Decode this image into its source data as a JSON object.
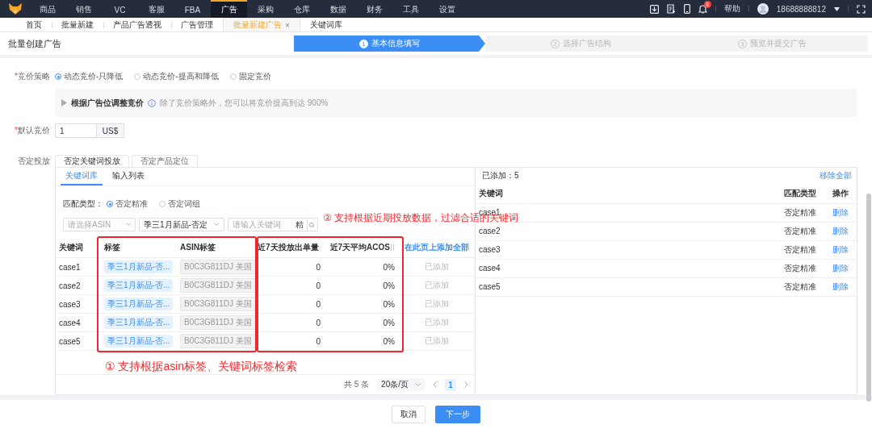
{
  "nav": {
    "items": [
      {
        "label": "商品",
        "selected": false
      },
      {
        "label": "销售",
        "selected": false
      },
      {
        "label": "VC",
        "selected": false
      },
      {
        "label": "客服",
        "selected": false
      },
      {
        "label": "FBA",
        "selected": false
      },
      {
        "label": "广告",
        "selected": true
      },
      {
        "label": "采购",
        "selected": false
      },
      {
        "label": "仓库",
        "selected": false
      },
      {
        "label": "数据",
        "selected": false
      },
      {
        "label": "财务",
        "selected": false
      },
      {
        "label": "工具",
        "selected": false
      },
      {
        "label": "设置",
        "selected": false
      }
    ],
    "notifications": "8",
    "help": "帮助",
    "user": "18688888812"
  },
  "tabs": [
    {
      "label": "首页",
      "selected": false
    },
    {
      "label": "批量新建",
      "selected": false
    },
    {
      "label": "产品广告透视",
      "selected": false
    },
    {
      "label": "广告管理",
      "selected": false
    },
    {
      "label": "批量新建广告",
      "selected": true,
      "close": "×"
    },
    {
      "label": "关键词库",
      "selected": false
    }
  ],
  "page_title": "批量创建广告",
  "steps": [
    {
      "number": "1",
      "label": "基本信息填写",
      "selected": true
    },
    {
      "number": "2",
      "label": "选择广告结构",
      "selected": false
    },
    {
      "number": "3",
      "label": "预览并提交广告",
      "selected": false
    }
  ],
  "bid_strategy": {
    "required_mark": "*",
    "label": "竞价策略",
    "options": [
      {
        "label": "动态竞价-只降低",
        "selected": true
      },
      {
        "label": "动态竞价-提高和降低",
        "selected": false
      },
      {
        "label": "固定竞价",
        "selected": false
      }
    ]
  },
  "placement": {
    "title": "根据广告位调整竞价",
    "hint": "除了竞价策略外，您可以将竞价提高到达 900%",
    "expanded": false
  },
  "default_bid": {
    "required_mark": "*",
    "label": "默认竞价",
    "value": "1",
    "unit": "US$"
  },
  "negative": {
    "label": "否定投放",
    "tabs": [
      {
        "label": "否定关键词投放",
        "selected": true
      },
      {
        "label": "否定产品定位",
        "selected": false
      }
    ],
    "subtabs": [
      {
        "label": "关键词库",
        "selected": true
      },
      {
        "label": "输入列表",
        "selected": false
      }
    ],
    "match_type": {
      "label": "匹配类型：",
      "options": [
        {
          "label": "否定精准",
          "selected": true
        },
        {
          "label": "否定词组",
          "selected": false
        }
      ]
    },
    "filters": {
      "asin_placeholder": "请选择ASIN",
      "tag_value": "季三1月新品-否定",
      "keyword_placeholder": "请输入关键词",
      "exact_toggle": "精"
    },
    "table": {
      "columns": [
        "关键词",
        "标签",
        "ASIN标签",
        "近7天投放出单量",
        "近7天平均ACOS"
      ],
      "add_all": "在此页上添加全部",
      "rows": [
        {
          "keyword": "case1",
          "tag": "季三1月新品-否...",
          "asin": "B0C3G811DJ 美国",
          "orders": "0",
          "acos": "0%",
          "status": "已添加"
        },
        {
          "keyword": "case2",
          "tag": "季三1月新品-否...",
          "asin": "B0C3G811DJ 美国",
          "orders": "0",
          "acos": "0%",
          "status": "已添加"
        },
        {
          "keyword": "case3",
          "tag": "季三1月新品-否...",
          "asin": "B0C3G811DJ 美国",
          "orders": "0",
          "acos": "0%",
          "status": "已添加"
        },
        {
          "keyword": "case4",
          "tag": "季三1月新品-否...",
          "asin": "B0C3G811DJ 美国",
          "orders": "0",
          "acos": "0%",
          "status": "已添加"
        },
        {
          "keyword": "case5",
          "tag": "季三1月新品-否...",
          "asin": "B0C3G811DJ 美国",
          "orders": "0",
          "acos": "0%",
          "status": "已添加"
        }
      ]
    },
    "pagination": {
      "total": "共 5 条",
      "page_size": "20条/页",
      "pages": [
        {
          "label": "1",
          "selected": true
        }
      ]
    },
    "added": {
      "count": "已添加：5",
      "remove_all": "移除全部",
      "columns": [
        "关键词",
        "匹配类型",
        "操作"
      ],
      "rows": [
        {
          "keyword": "case1",
          "match": "否定精准",
          "action": "删除"
        },
        {
          "keyword": "case2",
          "match": "否定精准",
          "action": "删除"
        },
        {
          "keyword": "case3",
          "match": "否定精准",
          "action": "删除"
        },
        {
          "keyword": "case4",
          "match": "否定精准",
          "action": "删除"
        },
        {
          "keyword": "case5",
          "match": "否定精准",
          "action": "删除"
        }
      ]
    }
  },
  "annotations": [
    {
      "text": "② 支持根据近期投放数据，过滤合适的关键词"
    },
    {
      "text": "① 支持根据asin标签、关键词标签检索"
    }
  ],
  "footer": {
    "cancel": "取消",
    "next": "下一步"
  }
}
